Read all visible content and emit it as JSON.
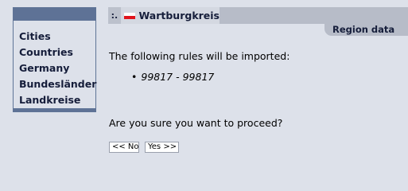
{
  "nav": {
    "items": [
      {
        "label": "Cities"
      },
      {
        "label": "Countries"
      },
      {
        "label": "Germany"
      },
      {
        "label": "Bundesländer"
      },
      {
        "label": "Landkreise"
      }
    ]
  },
  "header": {
    "marker": ":.",
    "flag_icon": "germany-flag-icon",
    "title": "Wartburgkreis"
  },
  "tabs": [
    {
      "label": "Region data"
    }
  ],
  "main": {
    "intro_text": "The following rules will be imported:",
    "rules": [
      {
        "text": "99817 - 99817"
      }
    ],
    "confirm_text": "Are you sure you want to proceed?",
    "no_button": "<< No",
    "yes_button": "Yes >>"
  },
  "colors": {
    "background": "#dde1ea",
    "nav_accent": "#5e7296",
    "title_bar": "#b7bcc8",
    "flag_red": "#e0141c"
  }
}
